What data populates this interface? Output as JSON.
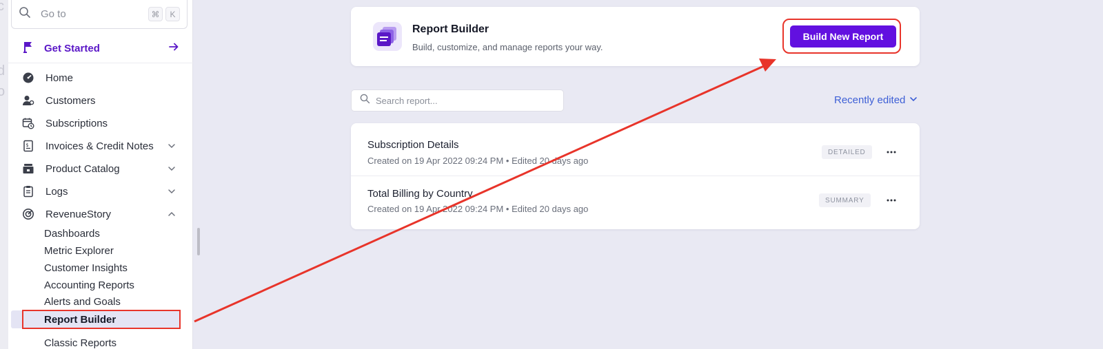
{
  "ghost": [
    "c",
    "d",
    "o"
  ],
  "search": {
    "placeholder": "Go to",
    "shortcut_cmd": "⌘",
    "shortcut_key": "K"
  },
  "get_started": {
    "label": "Get Started"
  },
  "nav": {
    "home": "Home",
    "customers": "Customers",
    "subscriptions": "Subscriptions",
    "invoices": "Invoices & Credit Notes",
    "catalog": "Product Catalog",
    "logs": "Logs",
    "revenuestory": "RevenueStory"
  },
  "subnav": {
    "dashboards": "Dashboards",
    "metric_explorer": "Metric Explorer",
    "customer_insights": "Customer Insights",
    "accounting_reports": "Accounting Reports",
    "alerts_goals": "Alerts and Goals",
    "report_builder": "Report Builder",
    "cut_item": "Classic Reports"
  },
  "header": {
    "title": "Report Builder",
    "subtitle": "Build, customize, and manage reports your way.",
    "build_button": "Build New Report"
  },
  "report_search": {
    "placeholder": "Search report..."
  },
  "sort": {
    "label": "Recently edited"
  },
  "reports": [
    {
      "name": "Subscription Details",
      "meta": "Created on 19 Apr 2022 09:24 PM • Edited 20 days ago",
      "type": "DETAILED"
    },
    {
      "name": "Total Billing by Country",
      "meta": "Created on 19 Apr 2022 09:24 PM • Edited 20 days ago",
      "type": "SUMMARY"
    }
  ],
  "colors": {
    "accent": "#6210e0",
    "brand_text": "#5a17c7",
    "link": "#3d5fd6",
    "annotation": "#e8342a"
  }
}
